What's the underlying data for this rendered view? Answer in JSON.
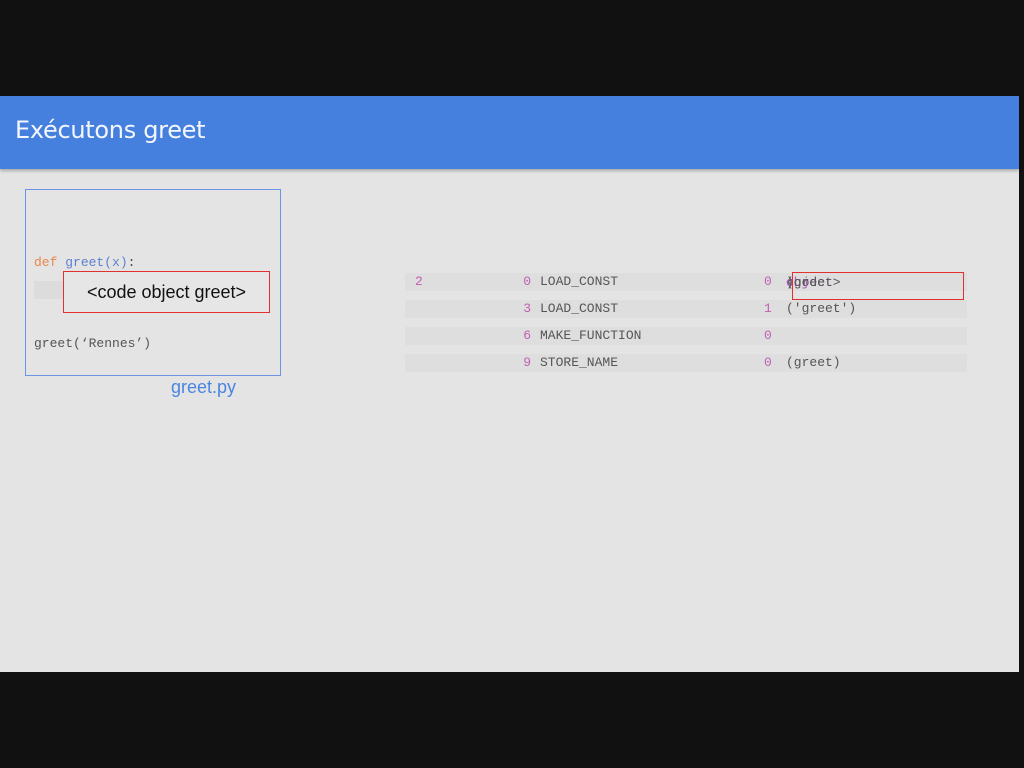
{
  "slide": {
    "title": "Exécutons greet"
  },
  "source": {
    "def_keyword": "def",
    "def_name": "greet(x)",
    "def_colon": ":",
    "call_line": "greet(‘Rennes’)",
    "code_object_label": "<code object greet>",
    "filename": "greet.py"
  },
  "disassembly": {
    "rows": [
      {
        "line": "2",
        "offset": "0",
        "opname": "LOAD_CONST",
        "arg": "0",
        "repr_open": "(",
        "repr_a": "<code ",
        "repr_b": "object",
        "repr_c": " greet>",
        "repr_close": ")"
      },
      {
        "line": "",
        "offset": "3",
        "opname": "LOAD_CONST",
        "arg": "1",
        "repr": "('greet')"
      },
      {
        "line": "",
        "offset": "6",
        "opname": "MAKE_FUNCTION",
        "arg": "0",
        "repr": ""
      },
      {
        "line": "",
        "offset": "9",
        "opname": "STORE_NAME",
        "arg": "0",
        "repr": "(greet)"
      }
    ]
  },
  "colors": {
    "header": "#4680de",
    "slide_bg": "#e4e4e4",
    "highlight_border": "#e03030",
    "number_color": "#c060b0"
  }
}
